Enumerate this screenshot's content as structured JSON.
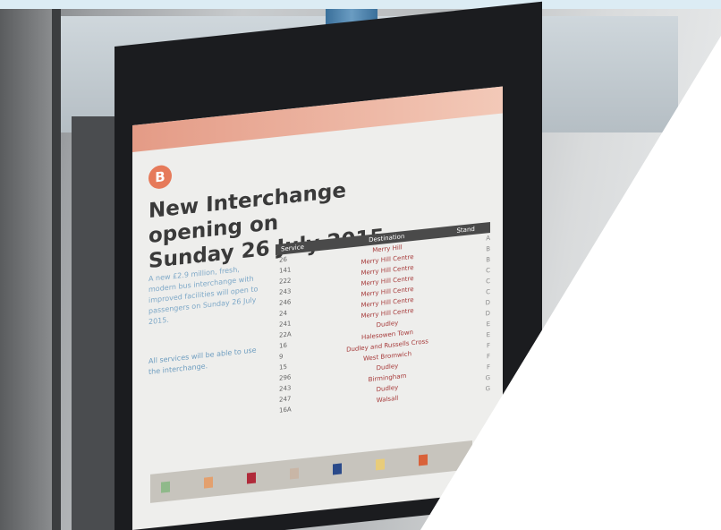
{
  "poster": {
    "title_line1": "New Interchange opening on",
    "title_line2": "Sunday 26 July 2015",
    "logo_glyph": "B",
    "intro_text": "A new £2.9 million, fresh, modern bus interchange with improved facilities will open to passengers on Sunday 26 July 2015.",
    "outro_text": "All services will be able to use the interchange.",
    "table": {
      "headers": [
        "Service",
        "Destination",
        "Stand"
      ],
      "rows": [
        {
          "route": "26",
          "destination": "Merry Hill",
          "stand": "A"
        },
        {
          "route": "141",
          "destination": "Merry Hill Centre",
          "stand": "B"
        },
        {
          "route": "222",
          "destination": "Merry Hill Centre",
          "stand": "B"
        },
        {
          "route": "243",
          "destination": "Merry Hill Centre",
          "stand": "C"
        },
        {
          "route": "246",
          "destination": "Merry Hill Centre",
          "stand": "C"
        },
        {
          "route": "24",
          "destination": "Merry Hill Centre",
          "stand": "C"
        },
        {
          "route": "241",
          "destination": "Merry Hill Centre",
          "stand": "D"
        },
        {
          "route": "22A",
          "destination": "Dudley",
          "stand": "D"
        },
        {
          "route": "16",
          "destination": "Halesowen Town",
          "stand": "E"
        },
        {
          "route": "9",
          "destination": "Dudley and Russells Cross",
          "stand": "E"
        },
        {
          "route": "15",
          "destination": "West Bromwich",
          "stand": "F"
        },
        {
          "route": "296",
          "destination": "Dudley",
          "stand": "F"
        },
        {
          "route": "243",
          "destination": "Birmingham",
          "stand": "F"
        },
        {
          "route": "247",
          "destination": "Dudley",
          "stand": "G"
        },
        {
          "route": "16A",
          "destination": "Walsall",
          "stand": "G"
        }
      ]
    },
    "legend_colors": [
      "#8fb98a",
      "#e3a06e",
      "#b02a3a",
      "#c9b6a6",
      "#2a4a8a",
      "#e8cc7a",
      "#d9623a"
    ]
  },
  "colors": {
    "poster_accent": "#e67a5a",
    "frame": "#1b1c1f",
    "blue_post": "#4a80ab"
  }
}
